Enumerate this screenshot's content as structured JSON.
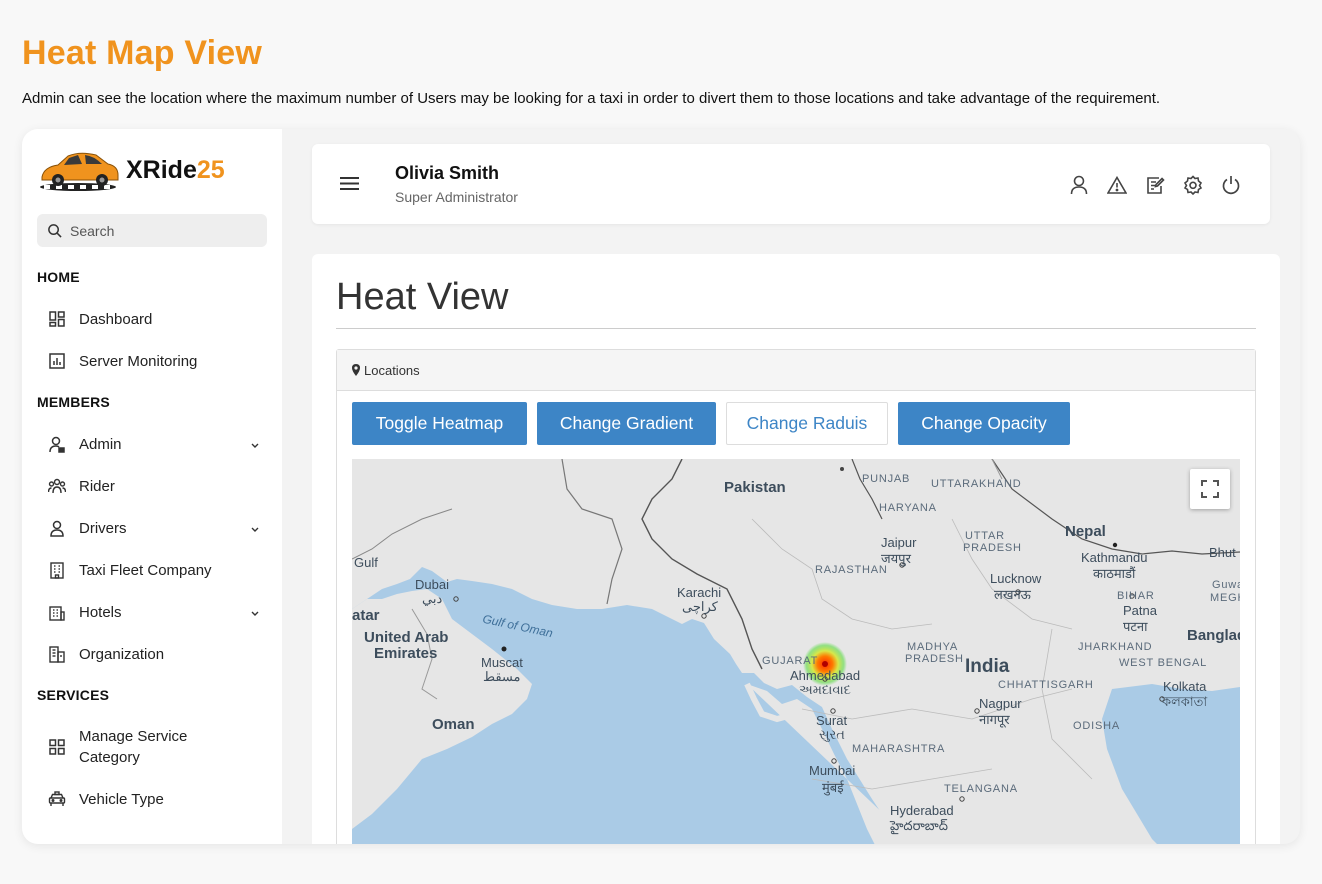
{
  "promo": {
    "title": "Heat Map View",
    "description": "Admin can see the location where the maximum number of Users may be looking for a taxi in order to divert them to those locations and take advantage of the requirement."
  },
  "brand": {
    "name_main": "XRide",
    "name_accent": "25",
    "accent_color": "#f0931e"
  },
  "sidebar": {
    "search_placeholder": "Search",
    "sections": {
      "home": "HOME",
      "members": "MEMBERS",
      "services": "SERVICES"
    },
    "items": [
      {
        "label": "Dashboard",
        "icon": "dashboard-icon"
      },
      {
        "label": "Server Monitoring",
        "icon": "chart-icon"
      },
      {
        "label": "Admin",
        "icon": "user-lock-icon",
        "expandable": true
      },
      {
        "label": "Rider",
        "icon": "users-icon"
      },
      {
        "label": "Drivers",
        "icon": "driver-icon",
        "expandable": true
      },
      {
        "label": "Taxi Fleet Company",
        "icon": "building-icon"
      },
      {
        "label": "Hotels",
        "icon": "hotel-icon",
        "expandable": true
      },
      {
        "label": "Organization",
        "icon": "organization-icon"
      },
      {
        "label": "Manage Service Category",
        "icon": "grid-icon"
      },
      {
        "label": "Vehicle Type",
        "icon": "car-icon"
      }
    ]
  },
  "topbar": {
    "user_name": "Olivia Smith",
    "user_role": "Super Administrator",
    "icons": [
      "user-icon",
      "alert-icon",
      "edit-icon",
      "settings-icon",
      "power-icon"
    ]
  },
  "main": {
    "page_title": "Heat View",
    "panel_title": "Locations",
    "buttons": {
      "toggle": "Toggle Heatmap",
      "gradient": "Change Gradient",
      "radius": "Change Raduis",
      "opacity": "Change Opacity"
    },
    "primary_color": "#3d85c6"
  },
  "map": {
    "labels": {
      "pakistan": "Pakistan",
      "punjab": "PUNJAB",
      "uttarakhand": "UTTARAKHAND",
      "haryana": "HARYANA",
      "nepal": "Nepal",
      "bhutan": "Bhut",
      "jaipur": "Jaipur",
      "jaipur_local": "जयपुर",
      "uttar_pradesh_1": "UTTAR",
      "uttar_pradesh_2": "PRADESH",
      "kathmandu": "Kathmandu",
      "kathmandu_local": "काठमाडौं",
      "rajasthan": "RAJASTHAN",
      "gulf": "Gulf",
      "lucknow": "Lucknow",
      "lucknow_local": "लखनऊ",
      "bihar": "BIHAR",
      "guwa": "Guwa",
      "megh": "MEGH",
      "dubai": "Dubai",
      "dubai_local": "دبي",
      "karachi": "Karachi",
      "karachi_local": "کراچی",
      "patna": "Patna",
      "patna_local": "पटना",
      "qatar": "atar",
      "gulf_of_oman": "Gulf of Oman",
      "uae_1": "United Arab",
      "uae_2": "Emirates",
      "bangla": "Banglad",
      "madhya_1": "MADHYA",
      "madhya_2": "PRADESH",
      "jharkhand": "JHARKHAND",
      "gujarat": "GUJARAT",
      "muscat": "Muscat",
      "muscat_local": "مسقط",
      "india": "India",
      "west_bengal": "WEST BENGAL",
      "ahmedabad": "Ahmedabad",
      "ahmedabad_local": "અમદાવાદ",
      "chhattisgarh": "CHHATTISGARH",
      "kolkata": "Kolkata",
      "kolkata_local": "কলকাতা",
      "nagpur": "Nagpur",
      "nagpur_local": "नागपूर",
      "oman": "Oman",
      "surat": "Surat",
      "surat_local": "સુરત",
      "odisha": "ODISHA",
      "maharashtra": "MAHARASHTRA",
      "mumbai": "Mumbai",
      "mumbai_local": "मुंबई",
      "telangana": "TELANGANA",
      "hyderabad": "Hyderabad",
      "hyderabad_local": "హైదరాబాద్"
    }
  }
}
